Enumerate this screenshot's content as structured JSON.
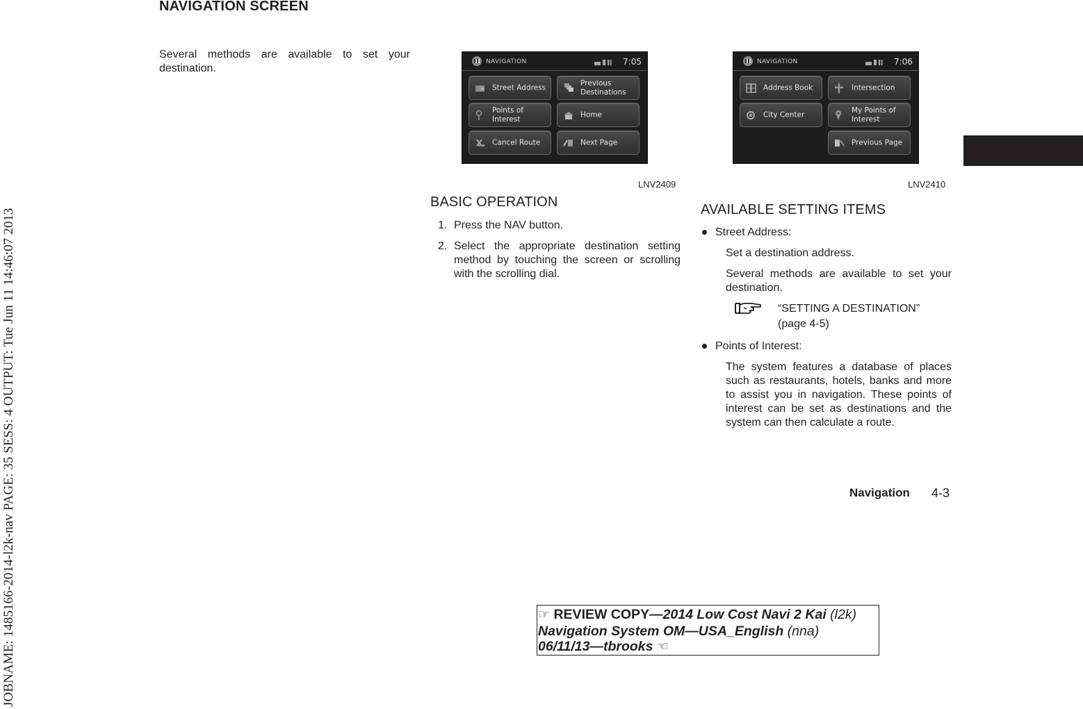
{
  "job_stamp": "JOBNAME: 1485166-2014-l2k-nav  PAGE: 35  SESS: 4  OUTPUT: Tue Jun 11 14:46:07 2013",
  "section_title": "NAVIGATION SCREEN",
  "intro_text": "Several methods are available to set your destination.",
  "figures": [
    {
      "id_label": "LNV2409",
      "screen": {
        "title": "NAVIGATION",
        "time": "7:05",
        "buttons": [
          {
            "label": "Street Address",
            "icon": "street-address-icon"
          },
          {
            "label": "Previous\nDestinations",
            "icon": "previous-destinations-icon"
          },
          {
            "label": "Points of\nInterest",
            "icon": "poi-pin-icon"
          },
          {
            "label": "Home",
            "icon": "home-icon"
          },
          {
            "label": "Cancel Route",
            "icon": "cancel-route-icon"
          },
          {
            "label": "Next Page",
            "icon": "next-page-icon"
          }
        ]
      }
    },
    {
      "id_label": "LNV2410",
      "screen": {
        "title": "NAVIGATION",
        "time": "7:06",
        "buttons": [
          {
            "label": "Address Book",
            "icon": "address-book-icon"
          },
          {
            "label": "Intersection",
            "icon": "intersection-icon"
          },
          {
            "label": "City Center",
            "icon": "city-center-icon"
          },
          {
            "label": "My Points of\nInterest",
            "icon": "my-poi-icon"
          },
          {
            "label": "Previous Page",
            "icon": "previous-page-icon"
          }
        ]
      }
    }
  ],
  "basic_operation": {
    "heading": "BASIC OPERATION",
    "steps": [
      {
        "num": "1.",
        "text": "Press the NAV button."
      },
      {
        "num": "2.",
        "text": "Select the appropriate destination setting method by touching the screen or scrolling with the scrolling dial."
      }
    ]
  },
  "available_items": {
    "heading": "AVAILABLE SETTING ITEMS",
    "items": [
      {
        "title": "Street Address:",
        "paragraphs": [
          "Set a destination address.",
          "Several methods are available to set your destination."
        ],
        "reference": {
          "title": "“SETTING A DESTINATION”",
          "page": "(page 4-5)"
        }
      },
      {
        "title": "Points of Interest:",
        "paragraphs": [
          "The system features a database of places such as restaurants, hotels, banks and more to assist you in navigation. These points of interest can be set as destinations and the system can then calculate a route."
        ]
      }
    ]
  },
  "footer": {
    "chapter": "Navigation",
    "page": "4-3"
  },
  "review_box": {
    "hand_right": "☞",
    "line1_bold": "REVIEW COPY—",
    "line1_italic": "2014 Low Cost Navi 2 Kai",
    "line1_code": " (l2k)",
    "line2_italic": "Navigation System OM—USA_English",
    "line2_code": " (nna)",
    "line3_italic": "06/11/13—tbrooks",
    "hand_left": "☜"
  }
}
